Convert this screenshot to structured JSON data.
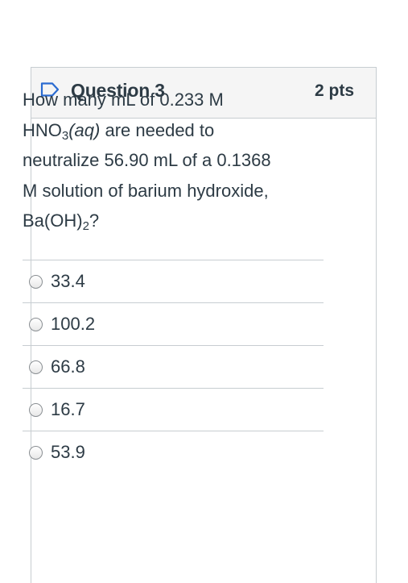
{
  "question": {
    "title": "Question 3",
    "points": "2 pts",
    "text_parts": {
      "line1": "How many mL of 0.233 M",
      "formula_prefix": "HNO",
      "formula_sub": "3",
      "formula_state": "(aq)",
      "line2_rest": " are needed to",
      "line3": "neutralize 56.90 mL of a 0.1368",
      "line4": "M solution of barium hydroxide,",
      "base_prefix": "Ba(OH)",
      "base_sub": "2",
      "base_suffix": "?"
    }
  },
  "answers": [
    {
      "label": "33.4"
    },
    {
      "label": "100.2"
    },
    {
      "label": "66.8"
    },
    {
      "label": "16.7"
    },
    {
      "label": "53.9"
    }
  ],
  "icons": {
    "flag": "bookmark-flag-icon"
  },
  "colors": {
    "flag_outline": "#2a6bd1",
    "text": "#2d3b45",
    "border": "#c7cdd1",
    "header_bg": "#f5f5f5"
  }
}
